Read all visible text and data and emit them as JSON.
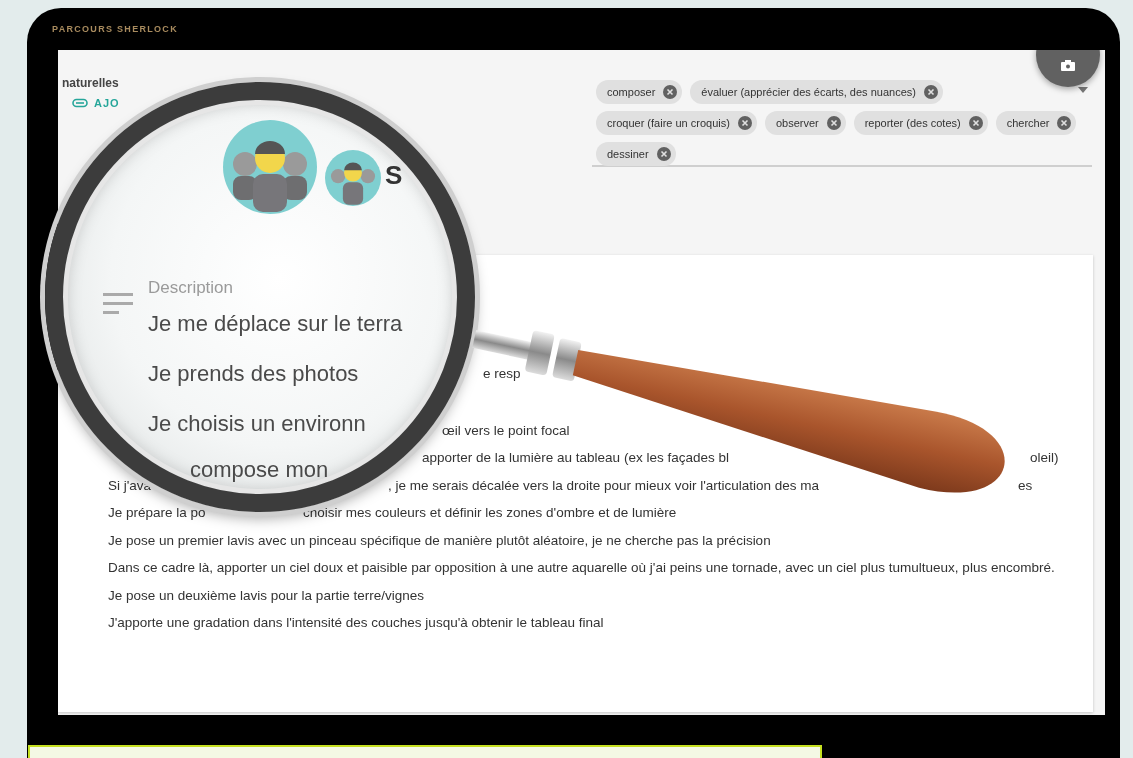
{
  "app_title": "PARCOURS SHERLOCK",
  "left_panel": {
    "label": "naturelles",
    "link": "AJO"
  },
  "skills": {
    "tags": [
      "composer",
      "évaluer (apprécier des écarts, des nuances)",
      "croquer (faire un croquis)",
      "observer",
      "reporter (des cotes)",
      "chercher",
      "dessiner"
    ]
  },
  "lens": {
    "avatar_label": "S",
    "description_label": "Description",
    "lines": [
      "Je me déplace sur le terra",
      "Je prends des photos",
      "Je choisis un environn",
      "compose mon"
    ]
  },
  "description": {
    "lines": [
      {
        "segments": [
          "e resp"
        ]
      },
      {
        "segments": [
          "œil vers le point focal"
        ]
      },
      {
        "segments": [
          "apporter de la lumière au tableau (ex les façades bl",
          "oleil)"
        ]
      },
      {
        "segments": [
          "Si j'ava",
          ", je me serais décalée vers la droite pour mieux voir l'articulation des ma",
          "es"
        ]
      },
      {
        "segments": [
          "Je prépare la po",
          "choisir mes couleurs et définir les zones d'ombre et de lumière"
        ]
      },
      {
        "segments": [
          "Je pose un premier lavis avec un pinceau spécifique de manière plutôt aléatoire, je ne cherche pas la précision"
        ]
      },
      {
        "segments": [
          "Dans ce cadre là, apporter un ciel doux et paisible par opposition à une autre aquarelle où j'ai peins une tornade, avec un ciel plus tumultueux, plus encombré."
        ]
      },
      {
        "segments": [
          "Je pose un deuxième lavis pour la partie terre/vignes"
        ]
      },
      {
        "segments": [
          "J'apporte une gradation dans l'intensité des couches jusqu'à obtenir le tableau final"
        ]
      }
    ]
  }
}
